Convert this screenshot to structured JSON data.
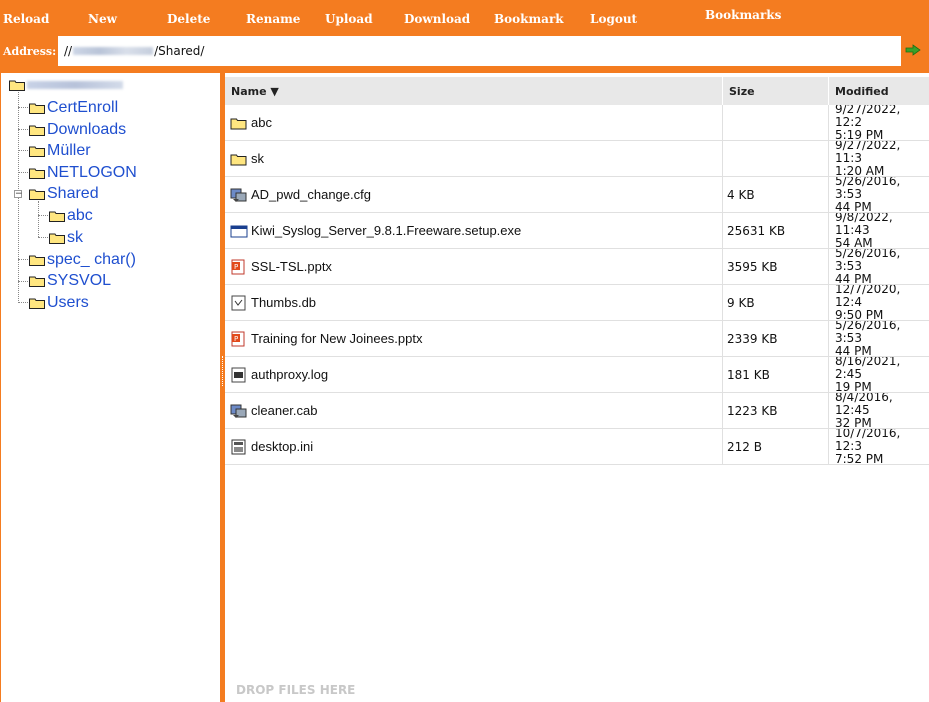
{
  "toolbar": {
    "reload": "Reload",
    "new": "New",
    "delete": "Delete",
    "rename": "Rename",
    "upload": "Upload",
    "download": "Download",
    "bookmark": "Bookmark",
    "logout": "Logout",
    "bookmarks": "Bookmarks"
  },
  "address": {
    "label": "Address:",
    "prefix": "//",
    "suffix": "/Shared/"
  },
  "tree": {
    "items": [
      {
        "label": "CertEnroll"
      },
      {
        "label": "Downloads"
      },
      {
        "label": "Müller"
      },
      {
        "label": "NETLOGON"
      },
      {
        "label": "Shared"
      },
      {
        "label": "abc"
      },
      {
        "label": "sk"
      },
      {
        "label": "spec_ char()"
      },
      {
        "label": "SYSVOL"
      },
      {
        "label": "Users"
      }
    ]
  },
  "table": {
    "headers": {
      "name": "Name ▼",
      "size": "Size",
      "modified": "Modified"
    },
    "rows": [
      {
        "name": "abc",
        "size": "",
        "modified": "9/27/2022, 12:2\n5:19 PM",
        "icon": "folder-icon"
      },
      {
        "name": "sk",
        "size": "",
        "modified": "9/27/2022, 11:3\n1:20 AM",
        "icon": "folder-icon"
      },
      {
        "name": "AD_pwd_change.cfg",
        "size": "4 KB",
        "modified": "5/26/2016, 3:53\n44 PM",
        "icon": "config-file-icon"
      },
      {
        "name": "Kiwi_Syslog_Server_9.8.1.Freeware.setup.exe",
        "size": "25631 KB",
        "modified": "9/8/2022, 11:43\n54 AM",
        "icon": "executable-icon"
      },
      {
        "name": "SSL-TSL.pptx",
        "size": "3595 KB",
        "modified": "5/26/2016, 3:53\n44 PM",
        "icon": "powerpoint-icon"
      },
      {
        "name": "Thumbs.db",
        "size": "9 KB",
        "modified": "12/7/2020, 12:4\n9:50 PM",
        "icon": "database-file-icon"
      },
      {
        "name": "Training for New Joinees.pptx",
        "size": "2339 KB",
        "modified": "5/26/2016, 3:53\n44 PM",
        "icon": "powerpoint-icon"
      },
      {
        "name": "authproxy.log",
        "size": "181 KB",
        "modified": "8/16/2021, 2:45\n19 PM",
        "icon": "log-file-icon"
      },
      {
        "name": "cleaner.cab",
        "size": "1223 KB",
        "modified": "8/4/2016, 12:45\n32 PM",
        "icon": "config-file-icon"
      },
      {
        "name": "desktop.ini",
        "size": "212 B",
        "modified": "10/7/2016, 12:3\n7:52 PM",
        "icon": "ini-file-icon"
      }
    ]
  },
  "drop_zone": "DROP FILES HERE",
  "colors": {
    "accent": "#f47c20",
    "link": "#1f4fcf",
    "header_bg": "#e8e8e8",
    "folder": "#ffe680"
  }
}
